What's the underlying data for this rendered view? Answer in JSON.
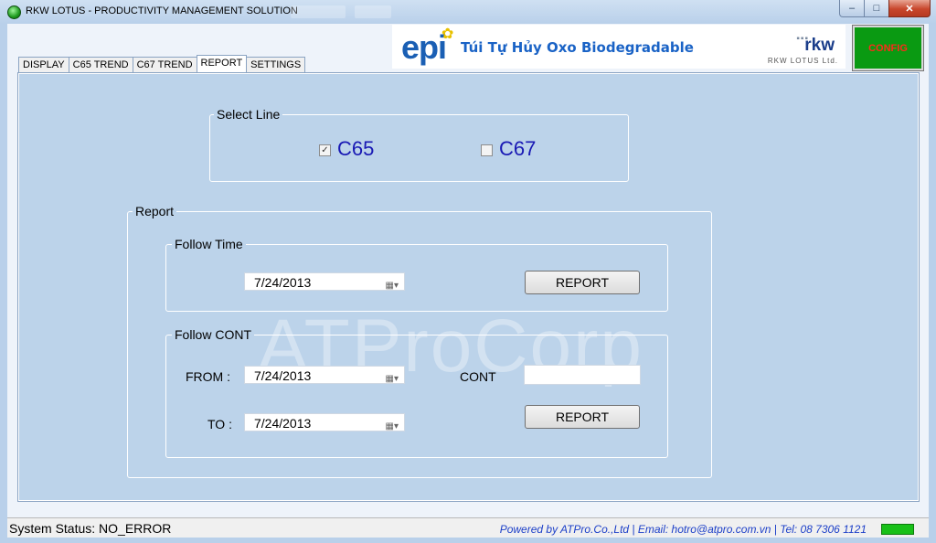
{
  "window": {
    "title": "RKW LOTUS - PRODUCTIVITY MANAGEMENT SOLUTION",
    "controls": {
      "minimize": "–",
      "maximize": "□",
      "close": "✕"
    }
  },
  "tabs": [
    {
      "label": "DISPLAY",
      "active": false
    },
    {
      "label": "C65 TREND",
      "active": false
    },
    {
      "label": "C67 TREND",
      "active": false
    },
    {
      "label": "REPORT",
      "active": true
    },
    {
      "label": "SETTINGS",
      "active": false
    }
  ],
  "banner": {
    "brand": "epi",
    "tagline": "Túi Tự Hủy Oxo Biodegradable",
    "logo": "rkw",
    "logo_sub": "RKW LOTUS Ltd."
  },
  "config_button": {
    "label": "CONFIG"
  },
  "watermark": "ATProCorp",
  "select_line": {
    "label": "Select Line",
    "options": [
      {
        "label": "C65",
        "checked": true
      },
      {
        "label": "C67",
        "checked": false
      }
    ]
  },
  "report": {
    "label": "Report",
    "follow_time": {
      "label": "Follow Time",
      "date": "7/24/2013",
      "button": "REPORT"
    },
    "follow_cont": {
      "label": "Follow CONT",
      "from_label": "FROM :",
      "from_date": "7/24/2013",
      "to_label": "TO :",
      "to_date": "7/24/2013",
      "cont_label": "CONT",
      "cont_value": "",
      "button": "REPORT"
    }
  },
  "status": {
    "text": "System Status: NO_ERROR",
    "powered": "Powered by ATPro.Co.,Ltd | Email: hotro@atpro.com.vn | Tel: 08 7306 1121",
    "led_color": "#18c018"
  },
  "icons": {
    "calendar": "▦▾",
    "check": "✓",
    "flower": "✿"
  }
}
